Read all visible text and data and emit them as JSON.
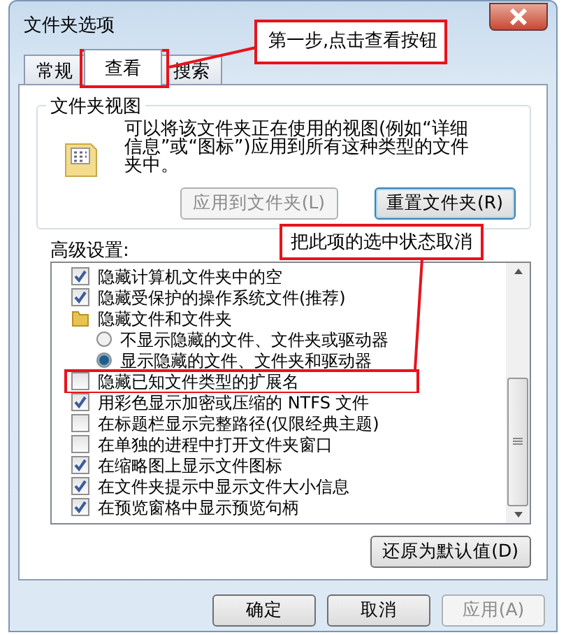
{
  "window": {
    "title": "文件夹选项"
  },
  "tabs": [
    {
      "label": "常规",
      "selected": false
    },
    {
      "label": "查看",
      "selected": true
    },
    {
      "label": "搜索",
      "selected": false
    }
  ],
  "folder_views": {
    "title": "文件夹视图",
    "description": "可以将该文件夹正在使用的视图(例如“详细信息”或“图标”)应用到所有这种类型的文件夹中。",
    "buttons": [
      {
        "label": "应用到文件夹(L)",
        "disabled": true
      },
      {
        "label": "重置文件夹(R)",
        "disabled": false
      }
    ]
  },
  "advanced": {
    "label": "高级设置:",
    "items": [
      {
        "kind": "checkbox",
        "label": "隐藏计算机文件夹中的空",
        "checked": true
      },
      {
        "kind": "checkbox",
        "label": "隐藏受保护的操作系统文件(推荐)",
        "checked": true
      },
      {
        "kind": "folder",
        "label": "隐藏文件和文件夹",
        "children": [
          {
            "kind": "radio",
            "label": "不显示隐藏的文件、文件夹或驱动器",
            "selected": false
          },
          {
            "kind": "radio",
            "label": "显示隐藏的文件、文件夹和驱动器",
            "selected": true
          }
        ]
      },
      {
        "kind": "checkbox",
        "label": "隐藏已知文件类型的扩展名",
        "checked": false
      },
      {
        "kind": "checkbox",
        "label": "用彩色显示加密或压缩的 NTFS 文件",
        "checked": true
      },
      {
        "kind": "checkbox",
        "label": "在标题栏显示完整路径(仅限经典主题)",
        "checked": false
      },
      {
        "kind": "checkbox",
        "label": "在单独的进程中打开文件夹窗口",
        "checked": false
      },
      {
        "kind": "checkbox",
        "label": "在缩略图上显示文件图标",
        "checked": true
      },
      {
        "kind": "checkbox",
        "label": "在文件夹提示中显示文件大小信息",
        "checked": true
      },
      {
        "kind": "checkbox",
        "label": "在预览窗格中显示预览句柄",
        "checked": true
      }
    ],
    "restore_button": "还原为默认值(D)"
  },
  "buttons": [
    {
      "label": "确定",
      "disabled": false
    },
    {
      "label": "取消",
      "disabled": false
    },
    {
      "label": "应用(A)",
      "disabled": true
    }
  ],
  "annotations": [
    {
      "text": "第一步,点击查看按钮"
    },
    {
      "text": "把此项的选中状态取消"
    }
  ]
}
